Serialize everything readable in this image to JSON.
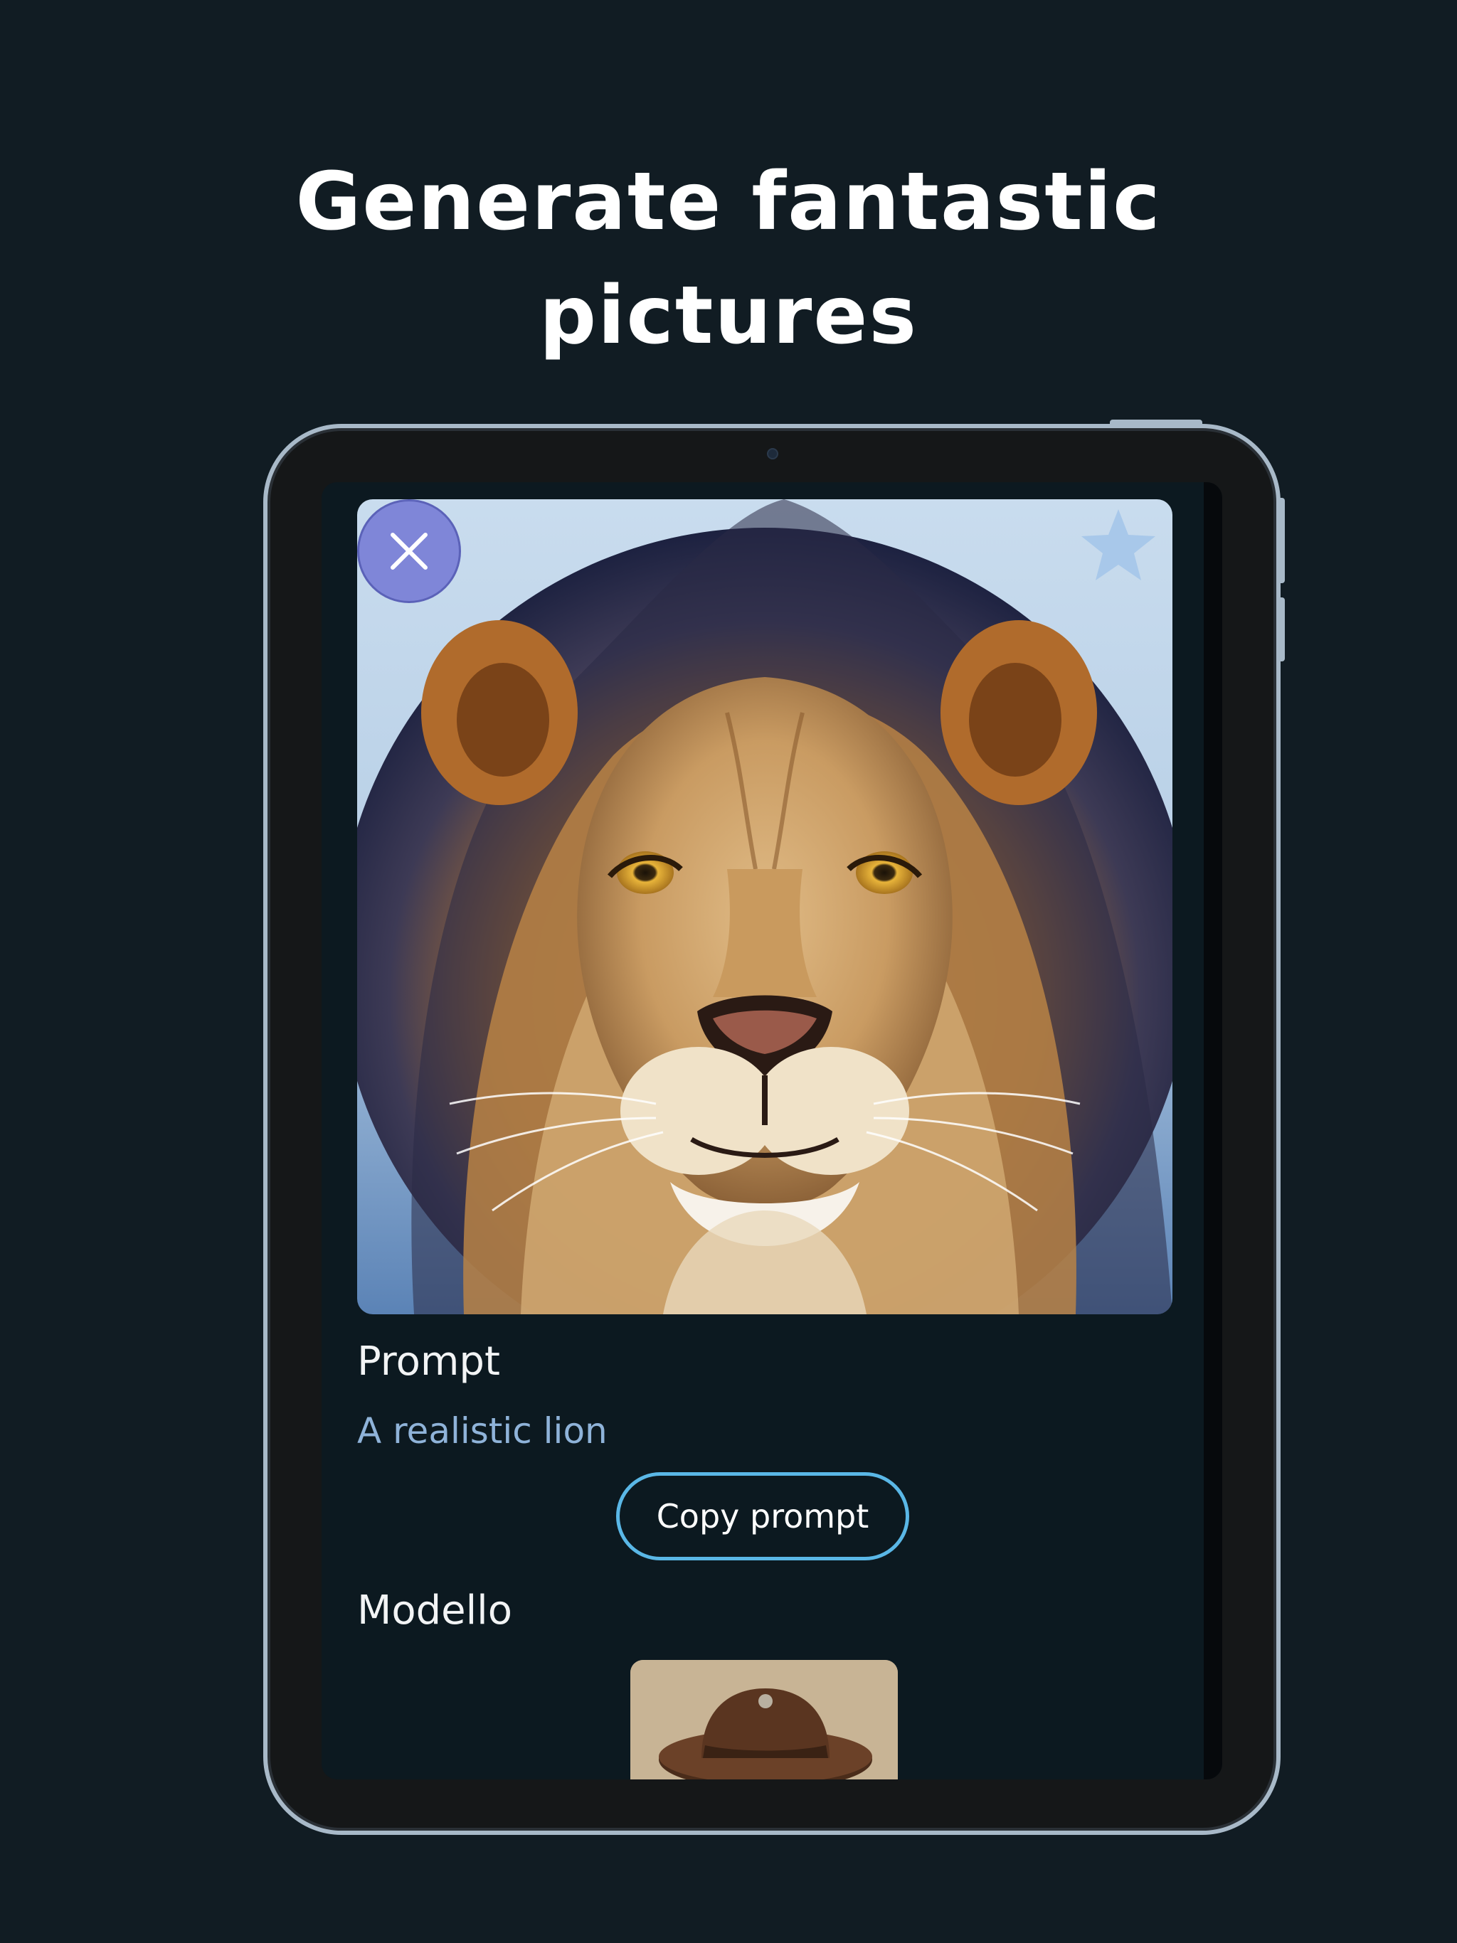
{
  "headline": {
    "line1": "Generate fantastic",
    "line2": "pictures"
  },
  "detail": {
    "prompt_label": "Prompt",
    "prompt_value": "A realistic lion",
    "copy_button_label": "Copy prompt",
    "model_label": "Modello"
  },
  "icons": {
    "close": "close-icon",
    "favorite": "star-icon",
    "generated_image": "lion-portrait-image",
    "model_thumbnail": "man-with-hat-image"
  },
  "colors": {
    "page_background": "#111c23",
    "screen_background": "#0c1920",
    "close_button": "#7f86d8",
    "copy_button_border": "#5ab7e6",
    "prompt_text": "#8fb3d9",
    "device_frame": "#a8b9c8"
  }
}
